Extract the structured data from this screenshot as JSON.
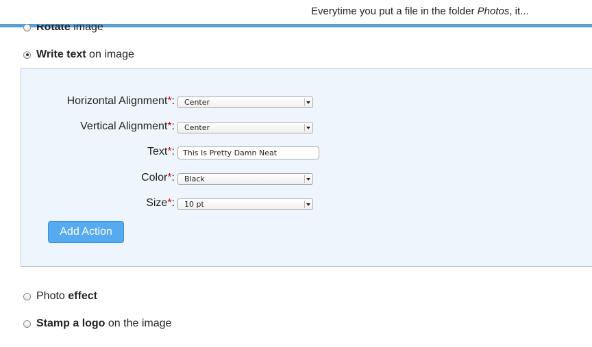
{
  "header": {
    "prefix": "Everytime you put a file in the folder ",
    "folder": "Photos",
    "suffix": ", it..."
  },
  "options": {
    "rotate": {
      "bold": "Rotate",
      "rest": " image"
    },
    "write_text": {
      "bold": "Write text",
      "rest": " on image"
    },
    "photo_effect": {
      "plain": "Photo ",
      "bold": "effect"
    },
    "stamp_logo": {
      "bold": "Stamp a logo",
      "rest": " on the image"
    }
  },
  "form": {
    "required_mark": "*",
    "colon": ":",
    "horizontal_alignment": {
      "label": "Horizontal Alignment",
      "value": "Center"
    },
    "vertical_alignment": {
      "label": "Vertical Alignment",
      "value": "Center"
    },
    "text": {
      "label": "Text",
      "value": "This Is Pretty Damn Neat"
    },
    "color": {
      "label": "Color",
      "value": "Black"
    },
    "size": {
      "label": "Size",
      "value": "10 pt"
    },
    "add_action_label": "Add Action"
  },
  "colors": {
    "accent": "#5a9fd6",
    "button": "#56aaf0",
    "panel_bg": "#eef5fd",
    "required": "#cc0000"
  }
}
